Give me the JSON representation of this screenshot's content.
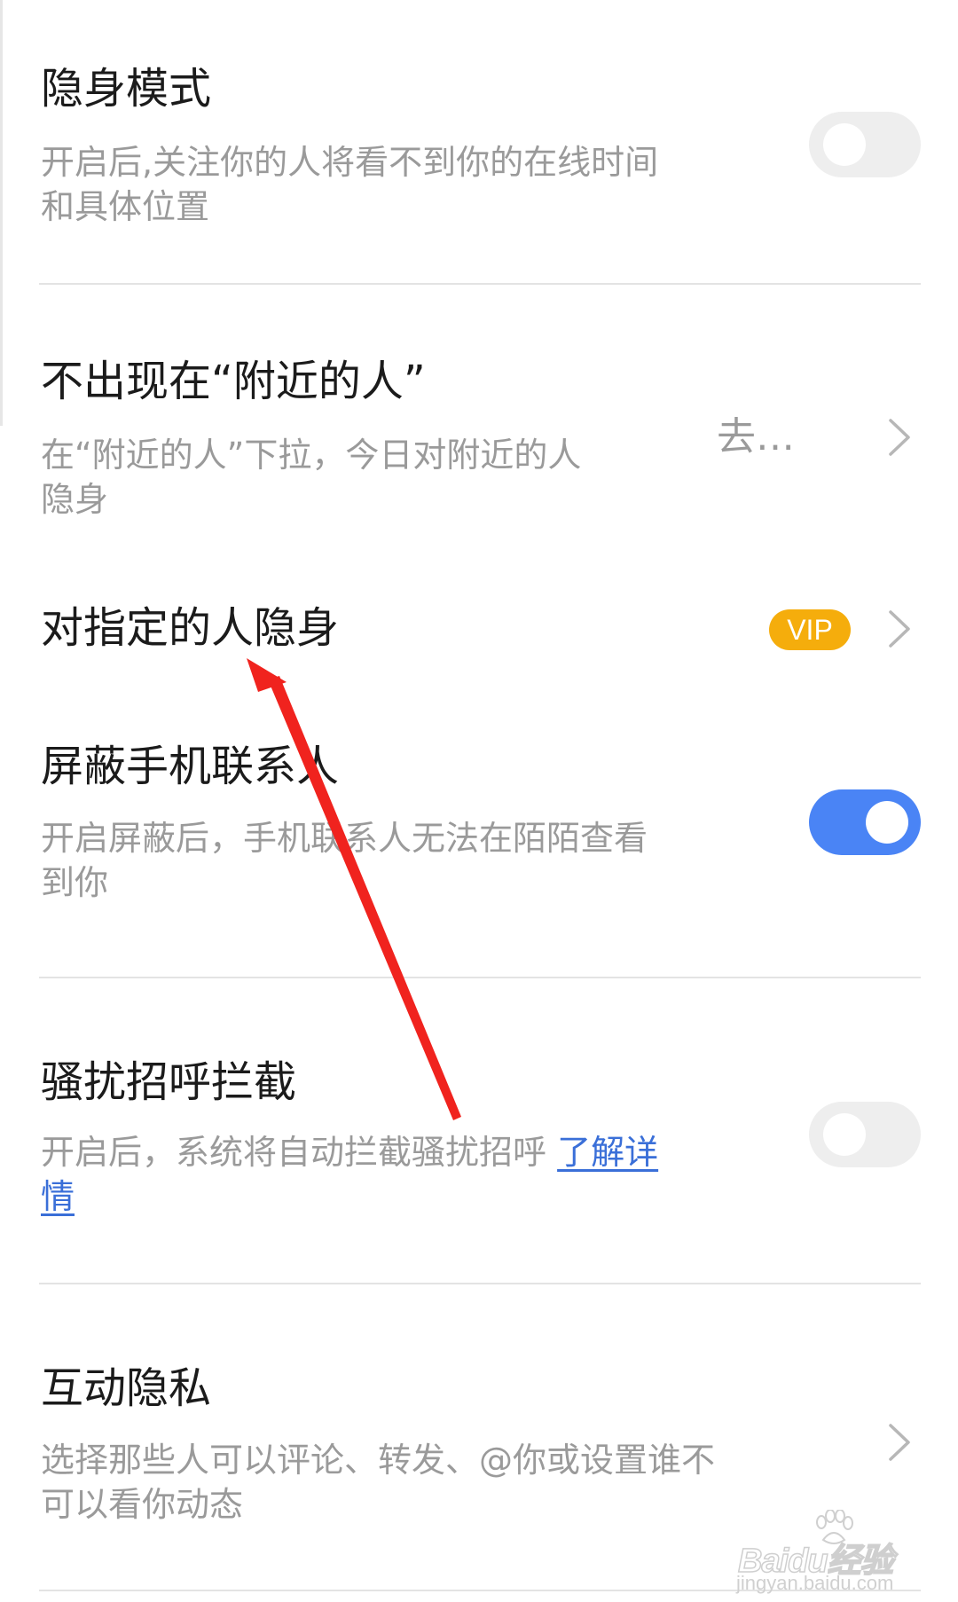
{
  "settings": {
    "stealth": {
      "title": "隐身模式",
      "desc": "开启后,关注你的人将看不到你的在线时间和具体位置",
      "enabled": false
    },
    "nearby": {
      "title": "不出现在“附近的人”",
      "desc": "在“附近的人”下拉，今日对附近的人隐身",
      "value": "去…"
    },
    "specified": {
      "title": "对指定的人隐身",
      "badge": "VIP"
    },
    "contacts": {
      "title": "屏蔽手机联系人",
      "desc": "开启屏蔽后，手机联系人无法在陌陌查看到你",
      "enabled": true
    },
    "harass": {
      "title": "骚扰招呼拦截",
      "desc": "开启后，系统将自动拦截骚扰招呼 ",
      "link": "了解详情",
      "enabled": false
    },
    "interaction": {
      "title": "互动隐私",
      "desc": "选择那些人可以评论、转发、@你或设置谁不可以看你动态"
    }
  },
  "watermark": {
    "brand": "Baidu经验",
    "url": "jingyan.baidu.com"
  },
  "colors": {
    "toggle_on": "#4a84f5",
    "toggle_off": "#eeeeee",
    "vip": "#f5ad0c",
    "link": "#3a6fd8",
    "arrow": "#f0231e"
  }
}
